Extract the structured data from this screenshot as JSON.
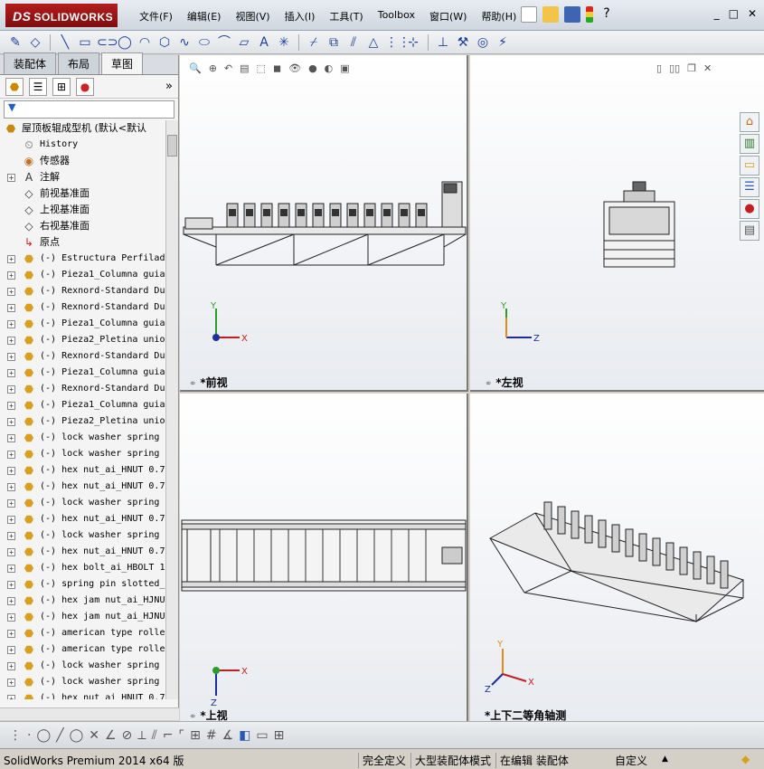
{
  "app": {
    "logo_ds": "DS",
    "logo_name": "SOLIDWORKS",
    "menu": [
      "文件(F)",
      "编辑(E)",
      "视图(V)",
      "插入(I)",
      "工具(T)",
      "Toolbox",
      "窗口(W)",
      "帮助(H)"
    ],
    "window_controls": [
      "_",
      "□",
      "✕"
    ]
  },
  "panel": {
    "tabs": [
      "装配体",
      "布局",
      "草图"
    ],
    "active_tab": "草图",
    "expand_glyph": "»",
    "filter_glyph": "▼",
    "tree": [
      {
        "label": "屋顶板辊成型机  (默认<默认",
        "icon": "assembly-icon",
        "root": true
      },
      {
        "label": "History",
        "icon": "history-icon",
        "mono": true
      },
      {
        "label": "传感器",
        "icon": "sensor-icon"
      },
      {
        "label": "注解",
        "icon": "annotation-icon",
        "expand": true
      },
      {
        "label": "前视基准面",
        "icon": "plane-icon"
      },
      {
        "label": "上视基准面",
        "icon": "plane-icon"
      },
      {
        "label": "右视基准面",
        "icon": "plane-icon"
      },
      {
        "label": "原点",
        "icon": "origin-icon"
      },
      {
        "label": "(-) Estructura Perfilad",
        "icon": "part-icon",
        "expand": true,
        "mono": true
      },
      {
        "label": "(-) Pieza1_Columna guia",
        "icon": "part-icon",
        "expand": true,
        "mono": true
      },
      {
        "label": "(-) Rexnord-Standard Du",
        "icon": "part-icon",
        "expand": true,
        "mono": true
      },
      {
        "label": "(-) Rexnord-Standard Du",
        "icon": "part-icon",
        "expand": true,
        "mono": true
      },
      {
        "label": "(-) Pieza1_Columna guia",
        "icon": "part-icon",
        "expand": true,
        "mono": true
      },
      {
        "label": "(-) Pieza2_Pletina unio",
        "icon": "part-icon",
        "expand": true,
        "mono": true
      },
      {
        "label": "(-) Rexnord-Standard Du",
        "icon": "part-icon",
        "expand": true,
        "mono": true
      },
      {
        "label": "(-) Pieza1_Columna guia",
        "icon": "part-icon",
        "expand": true,
        "mono": true
      },
      {
        "label": "(-) Rexnord-Standard Du",
        "icon": "part-icon",
        "expand": true,
        "mono": true
      },
      {
        "label": "(-) Pieza1_Columna guia",
        "icon": "part-icon",
        "expand": true,
        "mono": true
      },
      {
        "label": "(-) Pieza2_Pletina unio",
        "icon": "part-icon",
        "expand": true,
        "mono": true
      },
      {
        "label": "(-) lock washer spring",
        "icon": "part-icon",
        "expand": true,
        "mono": true
      },
      {
        "label": "(-) lock washer spring",
        "icon": "part-icon",
        "expand": true,
        "mono": true
      },
      {
        "label": "(-) hex nut_ai_HNUT 0.7",
        "icon": "part-icon",
        "expand": true,
        "mono": true
      },
      {
        "label": "(-) hex nut_ai_HNUT 0.7",
        "icon": "part-icon",
        "expand": true,
        "mono": true
      },
      {
        "label": "(-) lock washer spring",
        "icon": "part-icon",
        "expand": true,
        "mono": true
      },
      {
        "label": "(-) hex nut_ai_HNUT 0.7",
        "icon": "part-icon",
        "expand": true,
        "mono": true
      },
      {
        "label": "(-) lock washer spring",
        "icon": "part-icon",
        "expand": true,
        "mono": true
      },
      {
        "label": "(-) hex nut_ai_HNUT 0.7",
        "icon": "part-icon",
        "expand": true,
        "mono": true
      },
      {
        "label": "(-) hex bolt_ai_HBOLT 1",
        "icon": "part-icon",
        "expand": true,
        "mono": true
      },
      {
        "label": "(-) spring pin slotted_",
        "icon": "part-icon",
        "expand": true,
        "mono": true
      },
      {
        "label": "(-) hex jam nut_ai_HJNU",
        "icon": "part-icon",
        "expand": true,
        "mono": true
      },
      {
        "label": "(-) hex jam nut_ai_HJNU",
        "icon": "part-icon",
        "expand": true,
        "mono": true
      },
      {
        "label": "(-) american type rolle",
        "icon": "part-icon",
        "expand": true,
        "mono": true
      },
      {
        "label": "(-) american type rolle",
        "icon": "part-icon",
        "expand": true,
        "mono": true
      },
      {
        "label": "(-) lock washer spring",
        "icon": "part-icon",
        "expand": true,
        "mono": true
      },
      {
        "label": "(-) lock washer spring",
        "icon": "part-icon",
        "expand": true,
        "mono": true
      },
      {
        "label": "(-) hex nut_ai_HNUT 0.7",
        "icon": "part-icon",
        "expand": true,
        "mono": true
      }
    ]
  },
  "viewports": {
    "front": {
      "label": "*前视",
      "axis_h": "X",
      "axis_v": "Y"
    },
    "left": {
      "label": "*左视",
      "axis_h": "Z",
      "axis_v": "Y"
    },
    "top": {
      "label": "*上视",
      "axis_h": "X",
      "axis_v": "Z"
    },
    "iso": {
      "label": "*上下二等角轴测",
      "axis_x": "X",
      "axis_y": "Y",
      "axis_z": "Z"
    }
  },
  "status": {
    "product": "SolidWorks Premium 2014 x64 版",
    "state1": "完全定义",
    "state2": "大型装配体模式",
    "state3": "在编辑 装配体",
    "units": "自定义",
    "units_arrow": "▲"
  }
}
